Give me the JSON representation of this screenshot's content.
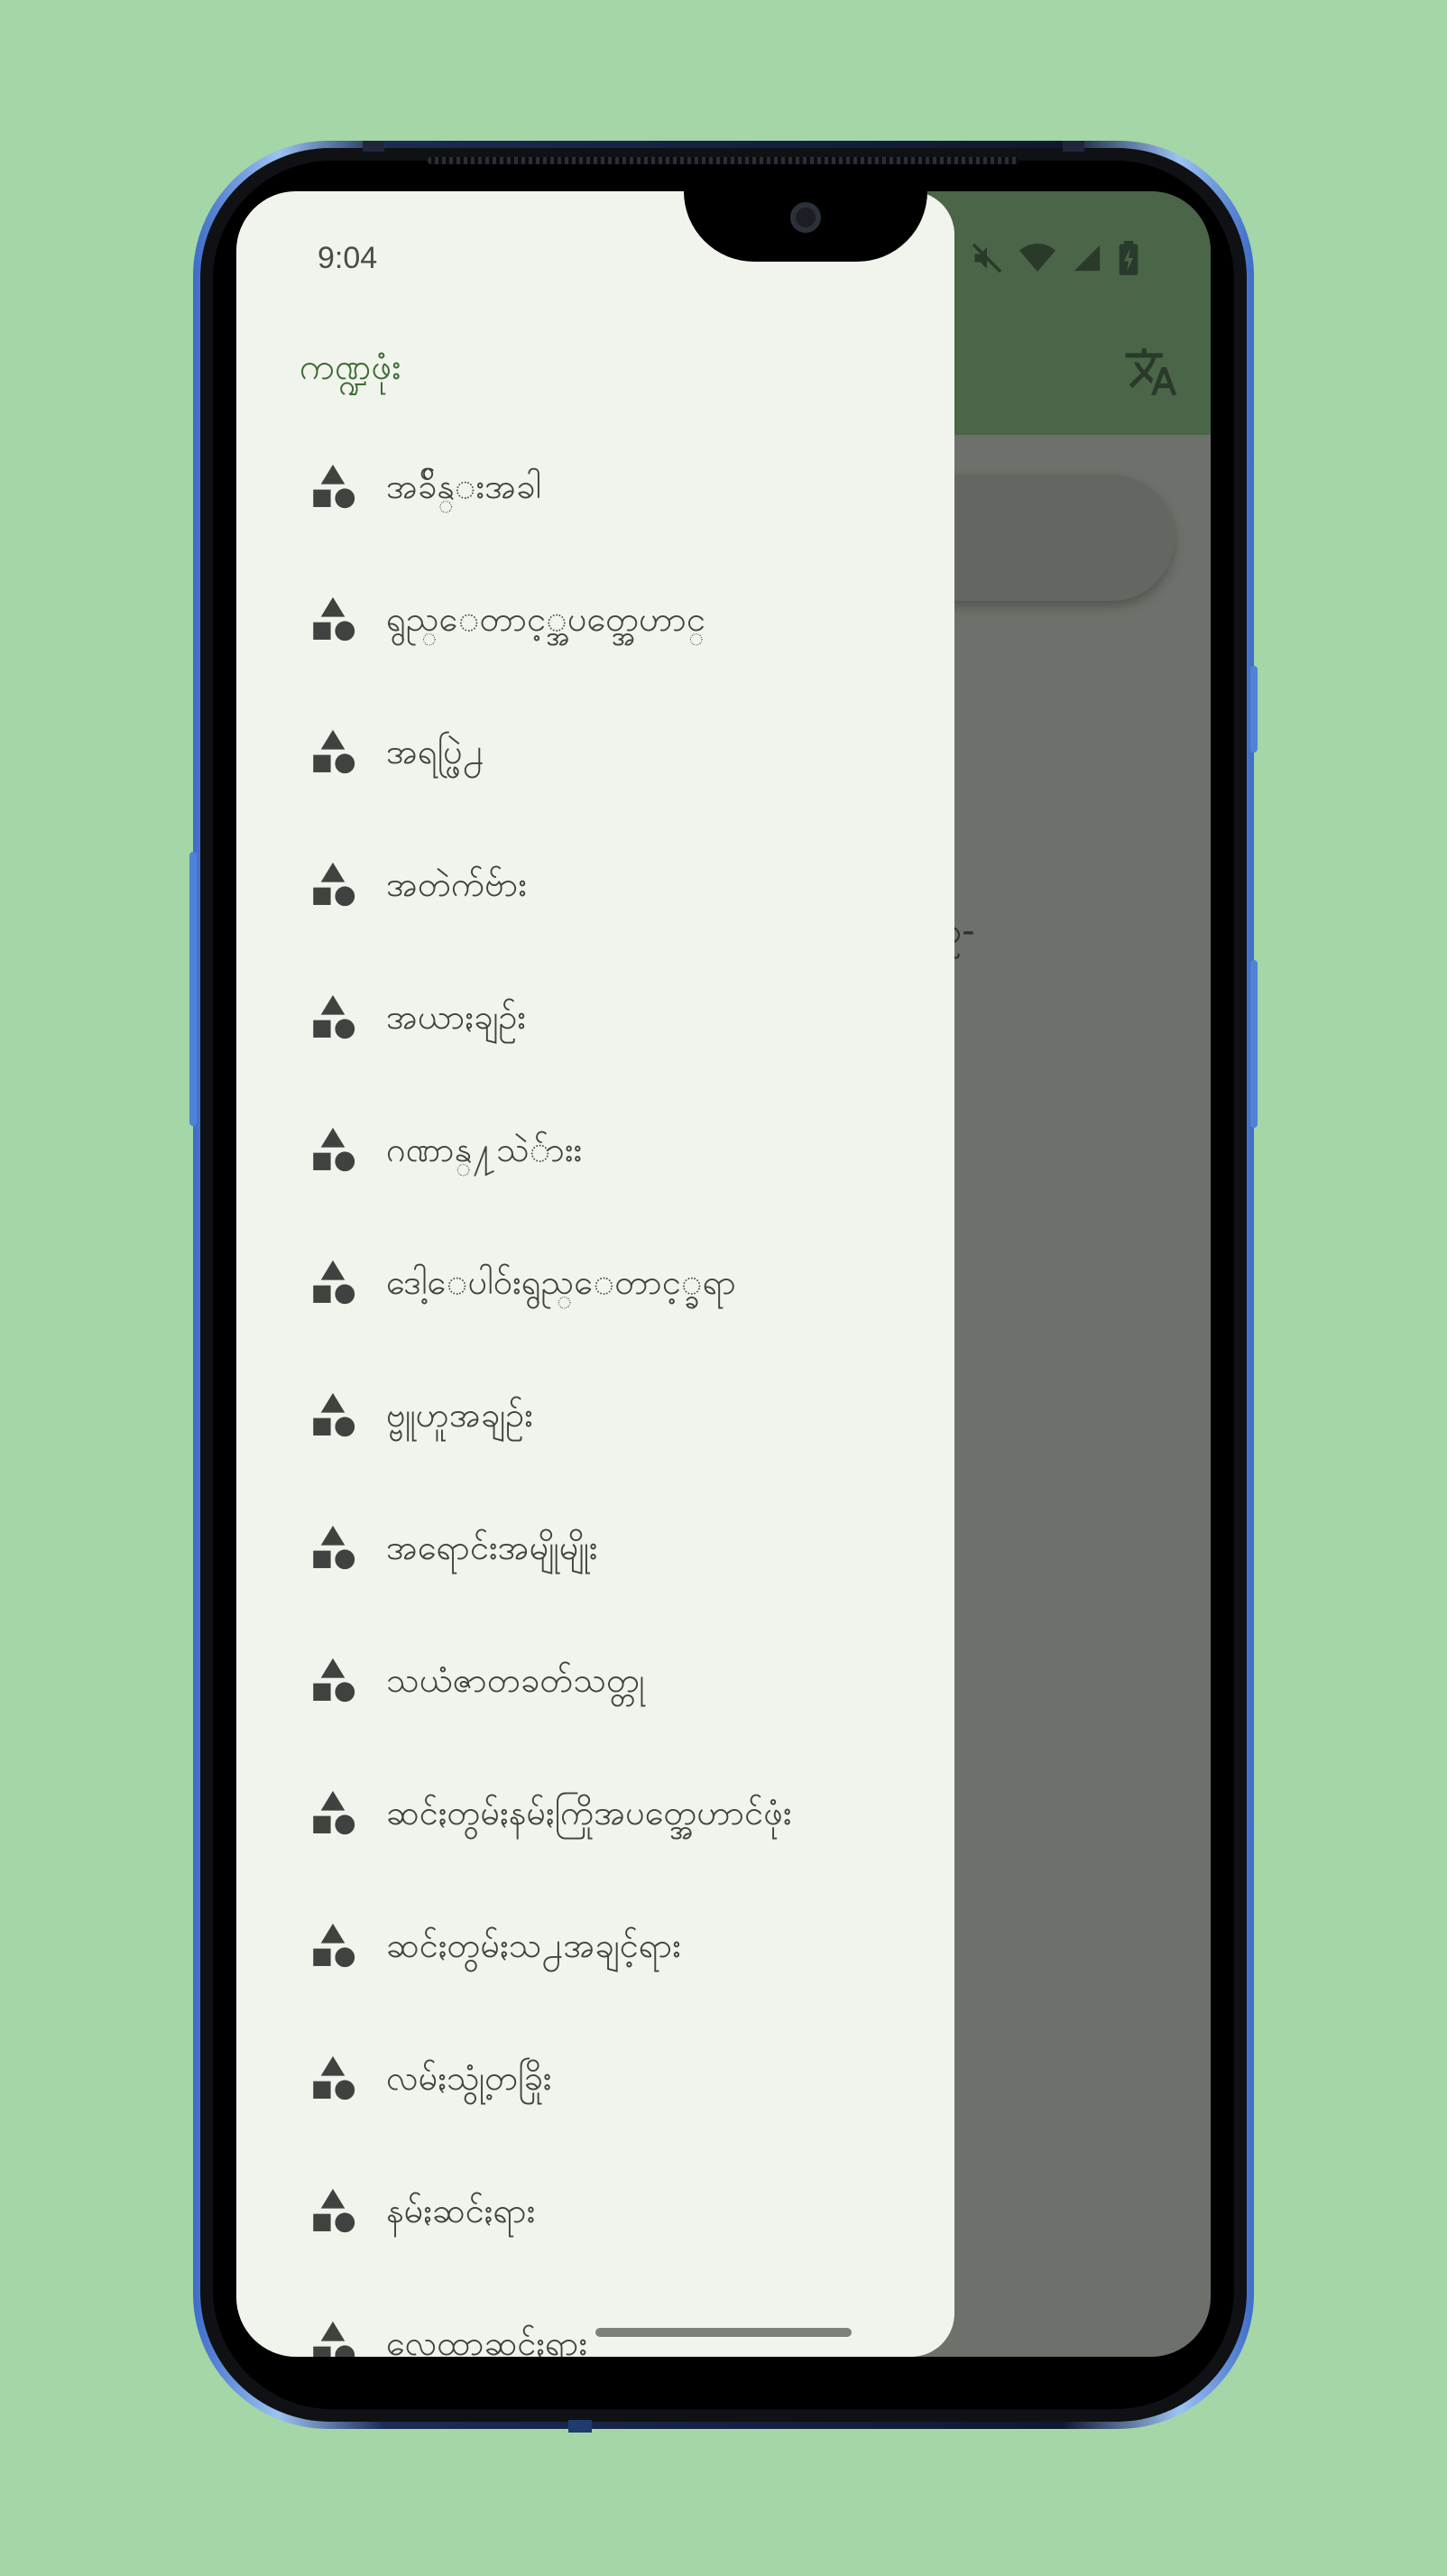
{
  "status_bar": {
    "time": "9:04"
  },
  "drawer": {
    "title": "ကဏ္ဍဖုံး",
    "items": [
      {
        "label": "အခ်ိန္းအခါ",
        "icon": "category-shapes-icon"
      },
      {
        "label": "ရွည္ေတာင့္အပတ္အေဟာင္",
        "icon": "category-shapes-icon"
      },
      {
        "label": "အရပ္ဖြဲ႕",
        "icon": "category-shapes-icon"
      },
      {
        "label": "အတဲက်ဗ်ား",
        "icon": "category-shapes-icon"
      },
      {
        "label": "အယာႏချဥ်း",
        "icon": "category-shapes-icon"
      },
      {
        "label": "ဂဏာန္႔သဲ်ားး",
        "icon": "category-shapes-icon"
      },
      {
        "label": "ဒေါ့ေပါဝ်းရွည္ေတာင့္ခရာ",
        "icon": "category-shapes-icon"
      },
      {
        "label": "ဗ္ဗူဟူအချဥ်း",
        "icon": "category-shapes-icon"
      },
      {
        "label": "အရောင်းအမျိုမျိုး",
        "icon": "category-shapes-icon"
      },
      {
        "label": "သယံဇာတခတ်သတ္တု",
        "icon": "category-shapes-icon"
      },
      {
        "label": "ဆင်ႏတွမ်ႏနမ်ႏကြိုအပတ္အေဟာင်ဖုံး",
        "icon": "category-shapes-icon"
      },
      {
        "label": "ဆင်ႏတွမ်ႏသ႕အချင့်ရား",
        "icon": "category-shapes-icon"
      },
      {
        "label": "လမ်ႏသွုံ့တခြိုး",
        "icon": "category-shapes-icon"
      },
      {
        "label": "နမ်ႏဆင်ႏရား",
        "icon": "category-shapes-icon"
      },
      {
        "label": "လေ့ထာ့ဆင်ႏရား",
        "icon": "category-shapes-icon"
      }
    ]
  },
  "background_app": {
    "partial_text": "ဥ-",
    "translate_icon": "translate-icon"
  },
  "colors": {
    "page_background": "#a4d6a7",
    "drawer_background": "#f1f4ec",
    "app_bar": "#4a6547",
    "title_accent": "#3d6b35",
    "scrim": "#6e716b"
  }
}
